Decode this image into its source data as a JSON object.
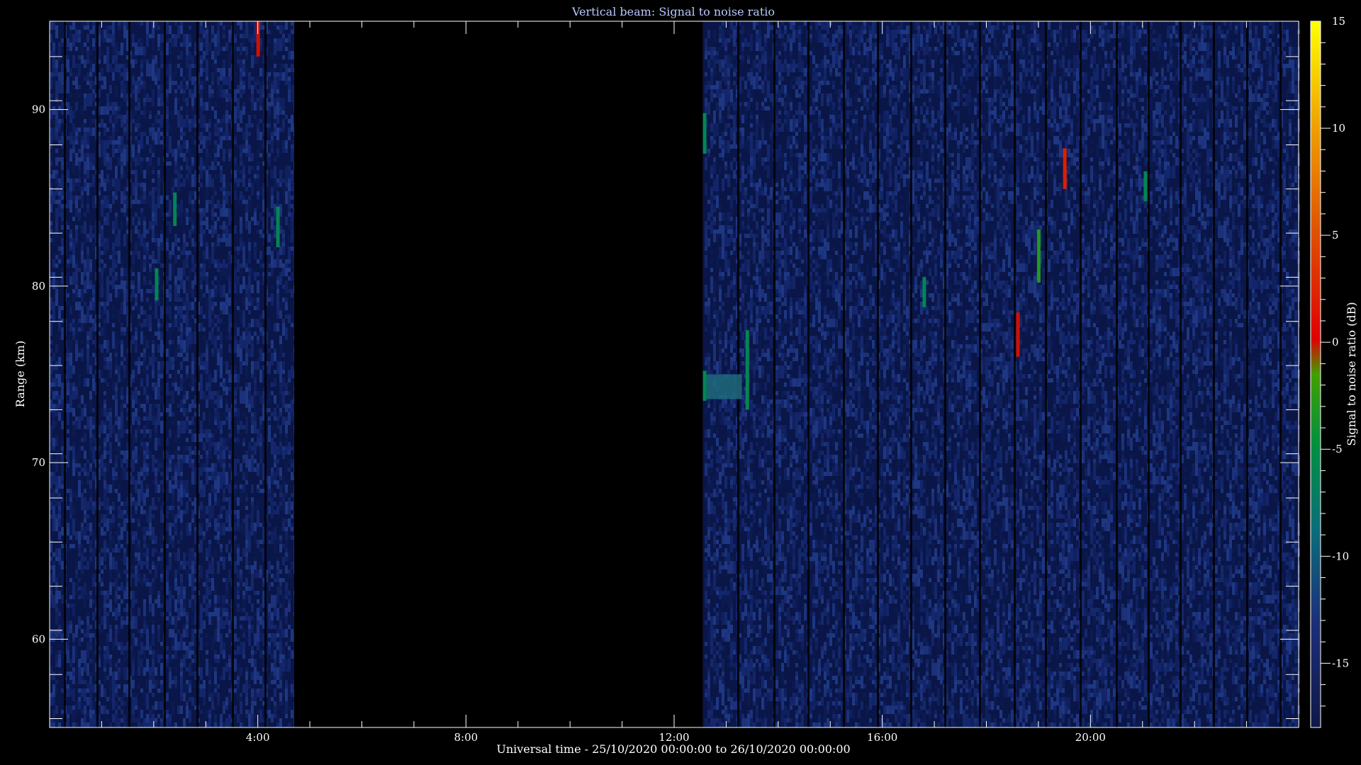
{
  "chart_data": {
    "type": "heatmap",
    "title": "Vertical beam: Signal to noise ratio",
    "xlabel": "Universal time - 25/10/2020 00:00:00 to 26/10/2020 00:00:00",
    "ylabel": "Range (km)",
    "colorbar_label": "Signal to noise ratio (dB)",
    "x_unit": "hours UT",
    "xlim": [
      0,
      24
    ],
    "ylim": [
      55,
      95
    ],
    "x_ticks": [
      4,
      8,
      12,
      16,
      20
    ],
    "x_tick_labels": [
      "4:00",
      "8:00",
      "12:00",
      "16:00",
      "20:00"
    ],
    "y_ticks": [
      60,
      70,
      80,
      90
    ],
    "y_tick_labels": [
      "60",
      "70",
      "80",
      "90"
    ],
    "colorbar_range": [
      -18,
      15
    ],
    "colorbar_ticks": [
      -15,
      -10,
      -5,
      0,
      5,
      10,
      15
    ],
    "colorbar_tick_labels": [
      "-15",
      "-10",
      "-5",
      "0",
      "5",
      "10",
      "15"
    ],
    "background_level_db": -17,
    "data_gaps": [
      [
        4.7,
        12.55
      ]
    ],
    "highlights": [
      {
        "t": 4.0,
        "y1": 93.0,
        "y2": 95.0,
        "snr": 0
      },
      {
        "t": 2.05,
        "y1": 79.2,
        "y2": 81.0,
        "snr": -6
      },
      {
        "t": 2.4,
        "y1": 83.4,
        "y2": 85.3,
        "snr": -6
      },
      {
        "t": 4.38,
        "y1": 82.2,
        "y2": 84.5,
        "snr": -6
      },
      {
        "t": 12.58,
        "y1": 87.5,
        "y2": 89.8,
        "snr": -6
      },
      {
        "t": 12.58,
        "y1": 73.5,
        "y2": 75.2,
        "snr": -6
      },
      {
        "t": 13.4,
        "y1": 73.0,
        "y2": 77.5,
        "snr": -6
      },
      {
        "t": 16.8,
        "y1": 78.8,
        "y2": 80.5,
        "snr": -6
      },
      {
        "t": 18.6,
        "y1": 76.0,
        "y2": 78.5,
        "snr": 0
      },
      {
        "t": 19.0,
        "y1": 80.2,
        "y2": 83.2,
        "snr": -3
      },
      {
        "t": 19.5,
        "y1": 85.5,
        "y2": 87.8,
        "snr": 2
      },
      {
        "t": 21.05,
        "y1": 84.8,
        "y2": 86.5,
        "snr": -6
      }
    ],
    "colors": {
      "low": "#0a1648",
      "mid": "#1a2d7a",
      "gap": "#000000",
      "axes": "#ffffff",
      "title": "#b8c8ff"
    }
  }
}
